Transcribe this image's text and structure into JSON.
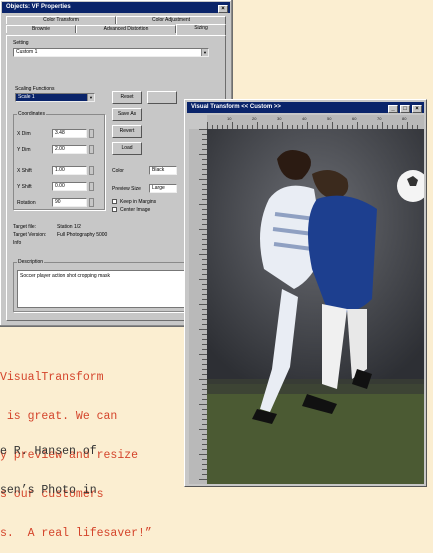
{
  "dialog": {
    "title": "Objects: VF Properties",
    "tabs_back": [
      "Color Transform",
      "Color Adjustment"
    ],
    "tabs_front": [
      "Brownie",
      "Advanced Distortion",
      "Sizing"
    ],
    "setting_label": "Setting",
    "setting_value": "Custom 1",
    "scaling_group_label": "Scaling Functions",
    "scaling_value": "Scale 1",
    "coords_label": "Coordinates",
    "coord_rows": [
      {
        "label": "X Dim",
        "value": "3.48"
      },
      {
        "label": "Y Dim",
        "value": "2.00"
      },
      {
        "label": "X Shift",
        "value": "1.00"
      },
      {
        "label": "Y Shift",
        "value": "0.00"
      },
      {
        "label": "Rotation",
        "value": "90"
      }
    ],
    "buttons": [
      "Reset",
      "Save As",
      "Revert",
      "Load"
    ],
    "extra_button": "",
    "color_label": "Color",
    "color_value": "Black",
    "preview_label": "Preview Size",
    "preview_value": "Large",
    "check1": "Keep in Margins",
    "check2": "Center Image",
    "target_label": "Target file:",
    "target_value": "Station 1/2",
    "version_label": "Target Version:",
    "version_value": "Full Photography 5000",
    "info_label": "Info",
    "description_label": "Description",
    "description_text": "Soccer player action shot cropping mask"
  },
  "viewer": {
    "title": "Visual Transform  <<  Custom  >>",
    "ruler_numbers": [
      "10",
      "20",
      "30",
      "40",
      "50",
      "60",
      "70",
      "80"
    ],
    "ball_color": "#f4f4f4",
    "jersey_colors": [
      "#e9edf4",
      "#1d3f8f"
    ]
  },
  "quote": {
    "lines": [
      "VisualTransform",
      " is great. We can",
      "y preview and resize",
      "s our customers",
      "s.  A real lifesaver!”"
    ],
    "attribution": [
      "e R. Hansen of",
      "sen’s Photo in"
    ]
  }
}
